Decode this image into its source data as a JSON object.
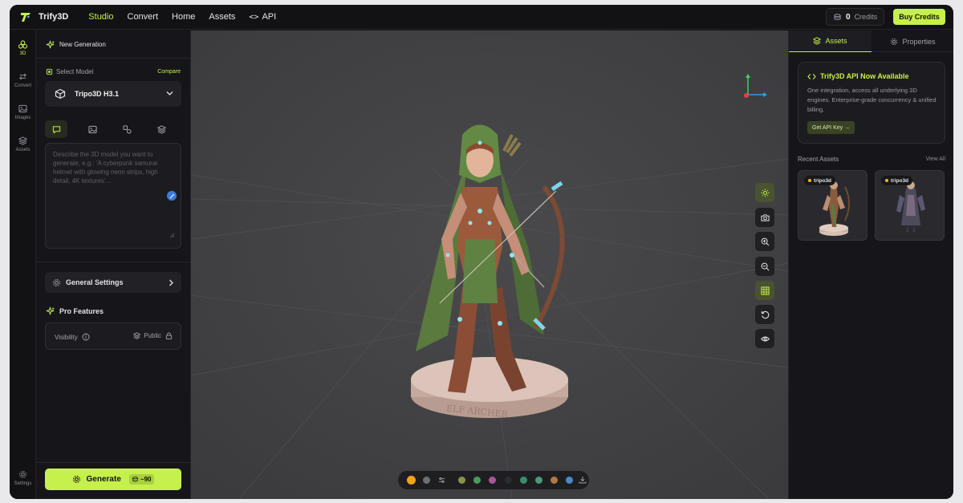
{
  "app": {
    "name": "Trify3D"
  },
  "nav": {
    "items": [
      {
        "label": "Studio",
        "active": true
      },
      {
        "label": "Convert"
      },
      {
        "label": "Home"
      },
      {
        "label": "Assets"
      }
    ],
    "api_code": "<>",
    "api_label": "API"
  },
  "header": {
    "credits_value": "0",
    "credits_label": "Credits",
    "buy_label": "Buy Credits"
  },
  "rail": {
    "items": [
      {
        "label": "3D",
        "active": true
      },
      {
        "label": "Convert"
      },
      {
        "label": "Images"
      },
      {
        "label": "Assets"
      }
    ],
    "settings_label": "Settings"
  },
  "panel": {
    "new_generation": "New Generation",
    "select_model_label": "Select Model",
    "compare_label": "Compare",
    "model_name": "Tripo3D H3.1",
    "prompt_placeholder": "Describe the 3D model you want to generate, e.g.: 'A cyberpunk samurai helmet with glowing neon strips, high detail, 4K textures'...",
    "general_settings": "General Settings",
    "pro_features": "Pro Features",
    "visibility_label": "Visibility",
    "visibility_value": "Public",
    "generate_label": "Generate",
    "generate_cost": "~90"
  },
  "viewport": {
    "base_text": "ELF ARCHER",
    "swatches": [
      "#f5a01e",
      "#6e6e73",
      "#8a9448",
      "#4a9a58",
      "#a8559c",
      "#2c2c2f",
      "#3d8c6b",
      "#4b9a7c",
      "#b07a3f",
      "#4f87c4"
    ]
  },
  "right": {
    "tab_assets": "Assets",
    "tab_properties": "Properties",
    "api_title": "Trify3D API Now Available",
    "api_desc": "One integration, access all underlying 3D engines. Enterprise-grade concurrency & unified billing.",
    "api_button": "Get API Key →",
    "recent_label": "Recent Assets",
    "view_all": "View All",
    "assets": [
      {
        "tag": "tripo3d"
      },
      {
        "tag": "tripo3d"
      }
    ]
  },
  "colors": {
    "accent": "#c6f04c",
    "background": "#131316",
    "viewport": "#424244"
  }
}
